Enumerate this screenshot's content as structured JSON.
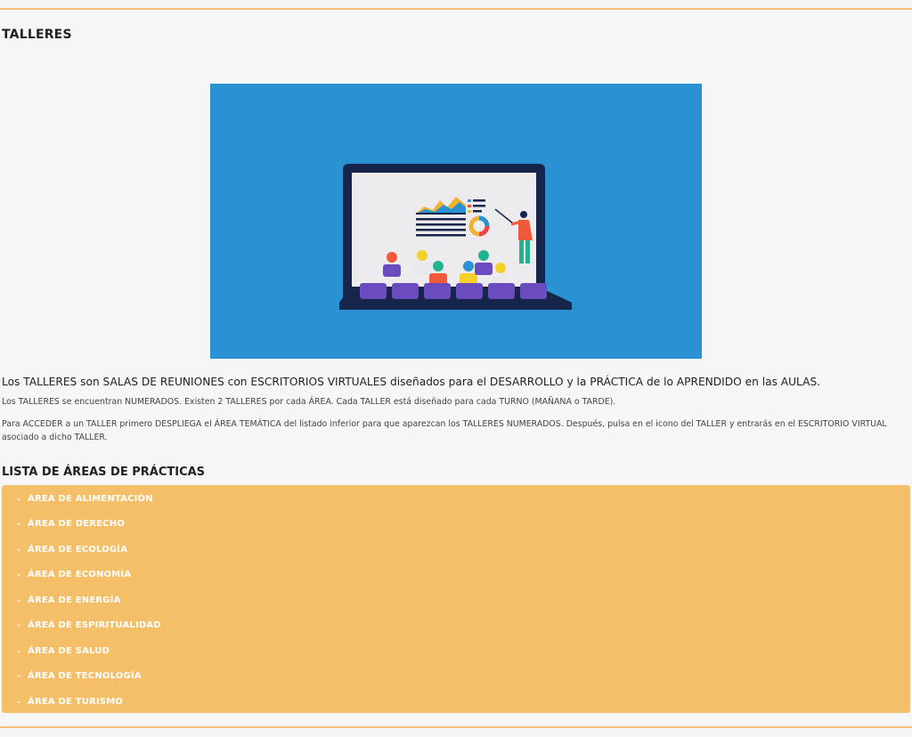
{
  "page": {
    "title": "TALLERES",
    "intro": "Los TALLERES son SALAS DE REUNIONES con ESCRITORIOS VIRTUALES diseñados para el DESARROLLO y la PRÁCTICA de lo APRENDIDO en las AULAS.",
    "paragraph1": "Los TALLERES se encuentran NUMERADOS. Existen 2 TALLERES por cada ÁREA. Cada TALLER está diseñado para cada TURNO (MAÑANA o TARDE).",
    "paragraph2": "Para ACCEDER a un TALLER primero DESPLIEGA el ÁREA TEMÁTICA del listado inferior para que aparezcan los TALLERES NUMERADOS. Después, pulsa en el icono del TALLER y entrarás en el ESCRITORIO VIRTUAL asociado a dicho TALLER."
  },
  "section": {
    "title": "LISTA DE ÁREAS DE PRÁCTICAS"
  },
  "areas": [
    {
      "label": "ÁREA DE ALIMENTACIÓN"
    },
    {
      "label": "ÁREA DE DERECHO"
    },
    {
      "label": "ÁREA DE ECOLOGÍA"
    },
    {
      "label": "ÁREA DE ECONOMÍA"
    },
    {
      "label": "ÁREA DE ENERGÍA"
    },
    {
      "label": "ÁREA DE ESPIRITUALIDAD"
    },
    {
      "label": "ÁREA DE SALUD"
    },
    {
      "label": "ÁREA DE TECNOLOGÍA"
    },
    {
      "label": "ÁREA DE TURISMO"
    }
  ],
  "icons": {
    "accordion_chevron": "chevron-down-icon",
    "chevron_glyph": "⌄"
  },
  "colors": {
    "accent": "#f5bf69",
    "rule": "#f6c079",
    "hero_bg": "#2a91d2"
  }
}
